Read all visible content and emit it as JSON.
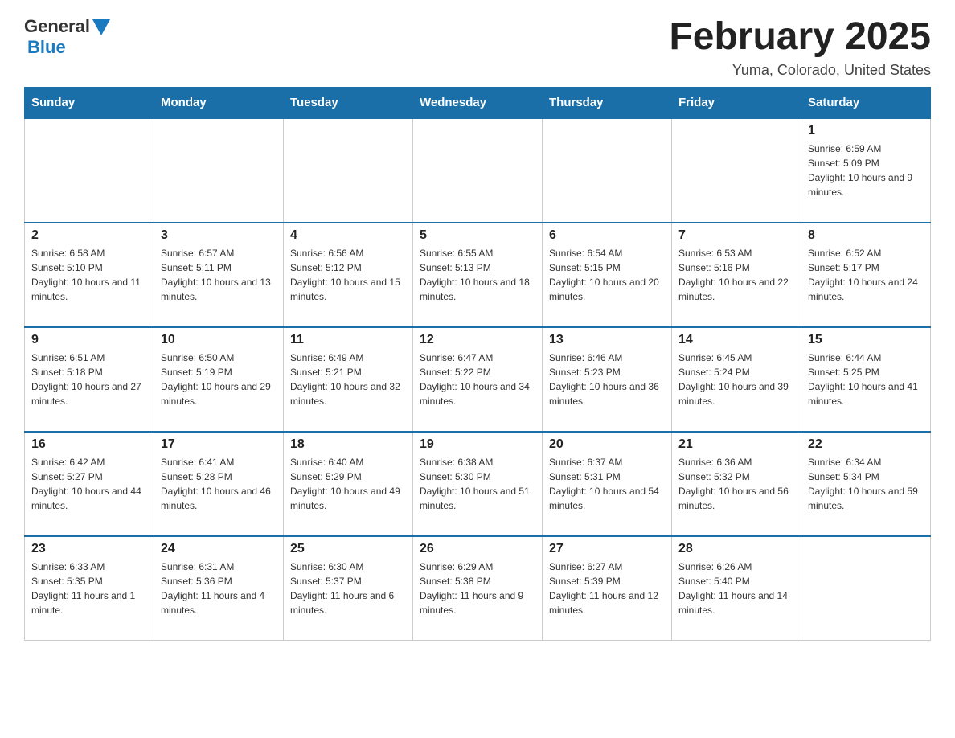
{
  "header": {
    "logo": {
      "general": "General",
      "blue": "Blue",
      "aria": "GeneralBlue logo"
    },
    "title": "February 2025",
    "location": "Yuma, Colorado, United States"
  },
  "calendar": {
    "weekdays": [
      "Sunday",
      "Monday",
      "Tuesday",
      "Wednesday",
      "Thursday",
      "Friday",
      "Saturday"
    ],
    "weeks": [
      [
        {
          "day": "",
          "info": ""
        },
        {
          "day": "",
          "info": ""
        },
        {
          "day": "",
          "info": ""
        },
        {
          "day": "",
          "info": ""
        },
        {
          "day": "",
          "info": ""
        },
        {
          "day": "",
          "info": ""
        },
        {
          "day": "1",
          "info": "Sunrise: 6:59 AM\nSunset: 5:09 PM\nDaylight: 10 hours and 9 minutes."
        }
      ],
      [
        {
          "day": "2",
          "info": "Sunrise: 6:58 AM\nSunset: 5:10 PM\nDaylight: 10 hours and 11 minutes."
        },
        {
          "day": "3",
          "info": "Sunrise: 6:57 AM\nSunset: 5:11 PM\nDaylight: 10 hours and 13 minutes."
        },
        {
          "day": "4",
          "info": "Sunrise: 6:56 AM\nSunset: 5:12 PM\nDaylight: 10 hours and 15 minutes."
        },
        {
          "day": "5",
          "info": "Sunrise: 6:55 AM\nSunset: 5:13 PM\nDaylight: 10 hours and 18 minutes."
        },
        {
          "day": "6",
          "info": "Sunrise: 6:54 AM\nSunset: 5:15 PM\nDaylight: 10 hours and 20 minutes."
        },
        {
          "day": "7",
          "info": "Sunrise: 6:53 AM\nSunset: 5:16 PM\nDaylight: 10 hours and 22 minutes."
        },
        {
          "day": "8",
          "info": "Sunrise: 6:52 AM\nSunset: 5:17 PM\nDaylight: 10 hours and 24 minutes."
        }
      ],
      [
        {
          "day": "9",
          "info": "Sunrise: 6:51 AM\nSunset: 5:18 PM\nDaylight: 10 hours and 27 minutes."
        },
        {
          "day": "10",
          "info": "Sunrise: 6:50 AM\nSunset: 5:19 PM\nDaylight: 10 hours and 29 minutes."
        },
        {
          "day": "11",
          "info": "Sunrise: 6:49 AM\nSunset: 5:21 PM\nDaylight: 10 hours and 32 minutes."
        },
        {
          "day": "12",
          "info": "Sunrise: 6:47 AM\nSunset: 5:22 PM\nDaylight: 10 hours and 34 minutes."
        },
        {
          "day": "13",
          "info": "Sunrise: 6:46 AM\nSunset: 5:23 PM\nDaylight: 10 hours and 36 minutes."
        },
        {
          "day": "14",
          "info": "Sunrise: 6:45 AM\nSunset: 5:24 PM\nDaylight: 10 hours and 39 minutes."
        },
        {
          "day": "15",
          "info": "Sunrise: 6:44 AM\nSunset: 5:25 PM\nDaylight: 10 hours and 41 minutes."
        }
      ],
      [
        {
          "day": "16",
          "info": "Sunrise: 6:42 AM\nSunset: 5:27 PM\nDaylight: 10 hours and 44 minutes."
        },
        {
          "day": "17",
          "info": "Sunrise: 6:41 AM\nSunset: 5:28 PM\nDaylight: 10 hours and 46 minutes."
        },
        {
          "day": "18",
          "info": "Sunrise: 6:40 AM\nSunset: 5:29 PM\nDaylight: 10 hours and 49 minutes."
        },
        {
          "day": "19",
          "info": "Sunrise: 6:38 AM\nSunset: 5:30 PM\nDaylight: 10 hours and 51 minutes."
        },
        {
          "day": "20",
          "info": "Sunrise: 6:37 AM\nSunset: 5:31 PM\nDaylight: 10 hours and 54 minutes."
        },
        {
          "day": "21",
          "info": "Sunrise: 6:36 AM\nSunset: 5:32 PM\nDaylight: 10 hours and 56 minutes."
        },
        {
          "day": "22",
          "info": "Sunrise: 6:34 AM\nSunset: 5:34 PM\nDaylight: 10 hours and 59 minutes."
        }
      ],
      [
        {
          "day": "23",
          "info": "Sunrise: 6:33 AM\nSunset: 5:35 PM\nDaylight: 11 hours and 1 minute."
        },
        {
          "day": "24",
          "info": "Sunrise: 6:31 AM\nSunset: 5:36 PM\nDaylight: 11 hours and 4 minutes."
        },
        {
          "day": "25",
          "info": "Sunrise: 6:30 AM\nSunset: 5:37 PM\nDaylight: 11 hours and 6 minutes."
        },
        {
          "day": "26",
          "info": "Sunrise: 6:29 AM\nSunset: 5:38 PM\nDaylight: 11 hours and 9 minutes."
        },
        {
          "day": "27",
          "info": "Sunrise: 6:27 AM\nSunset: 5:39 PM\nDaylight: 11 hours and 12 minutes."
        },
        {
          "day": "28",
          "info": "Sunrise: 6:26 AM\nSunset: 5:40 PM\nDaylight: 11 hours and 14 minutes."
        },
        {
          "day": "",
          "info": ""
        }
      ]
    ]
  }
}
